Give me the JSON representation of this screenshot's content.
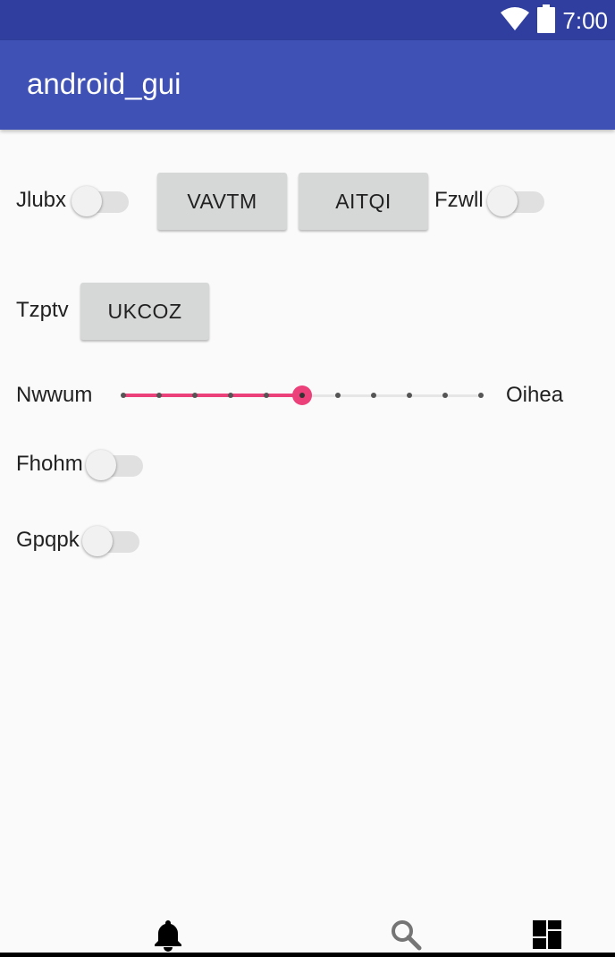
{
  "status_bar": {
    "time": "7:00",
    "icons": [
      "wifi-icon",
      "battery-icon"
    ]
  },
  "app_bar": {
    "title": "android_gui"
  },
  "row1": {
    "switch1_label": "Jlubx",
    "switch1_on": false,
    "button1_label": "VAVTM",
    "button2_label": "AITQI",
    "switch2_label": "Fzwll",
    "switch2_on": false
  },
  "row2": {
    "label": "Tzptv",
    "button_label": "UKCOZ"
  },
  "seekbar": {
    "left_label": "Nwwum",
    "right_label": "Oihea",
    "value": 5,
    "max": 10,
    "accent_color": "#ec407a"
  },
  "switch_fhohm": {
    "label": "Fhohm",
    "on": false
  },
  "switch_gpqpk": {
    "label": "Gpqpk",
    "on": false
  },
  "bottom_nav": {
    "items": [
      "bell-icon",
      "search-icon",
      "dashboard-icon"
    ],
    "selected": "bell-icon"
  },
  "colors": {
    "status_bar": "#303f9f",
    "app_bar": "#3f51b5",
    "background": "#fafafa",
    "button": "#d6d7d7"
  }
}
